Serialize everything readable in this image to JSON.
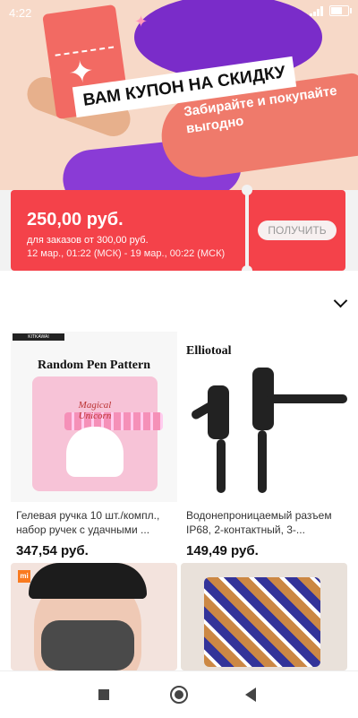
{
  "status_bar": {
    "time": "4:22",
    "battery_label": "8"
  },
  "banner": {
    "headline": "ВАМ КУПОН НА СКИДКУ",
    "subline": "Забирайте и покупайте выгодно"
  },
  "coupon": {
    "amount": "250,00 руб.",
    "condition": "для заказов от 300,00 руб.",
    "validity": "12 мар., 01:22 (МСК) - 19 мар., 00:22 (МСК)",
    "claim_label": "ПОЛУЧИТЬ"
  },
  "products": [
    {
      "image_caption": "Random Pen Pattern",
      "image_script": "Magical Unicorn",
      "title": "Гелевая ручка 10 шт./компл., набор ручек с удачными ...",
      "price": "347,54 руб."
    },
    {
      "image_caption": "Elliotoal",
      "title": "Водонепроницаемый разъем IP68, 2-контактный, 3-...",
      "price": "149,49 руб."
    }
  ],
  "bottom_cards": [
    {
      "brand_badge": "mi"
    },
    {
      "brand_badge": ""
    }
  ],
  "colors": {
    "accent": "#f4424a",
    "banner_bg": "#f7d9c8"
  }
}
